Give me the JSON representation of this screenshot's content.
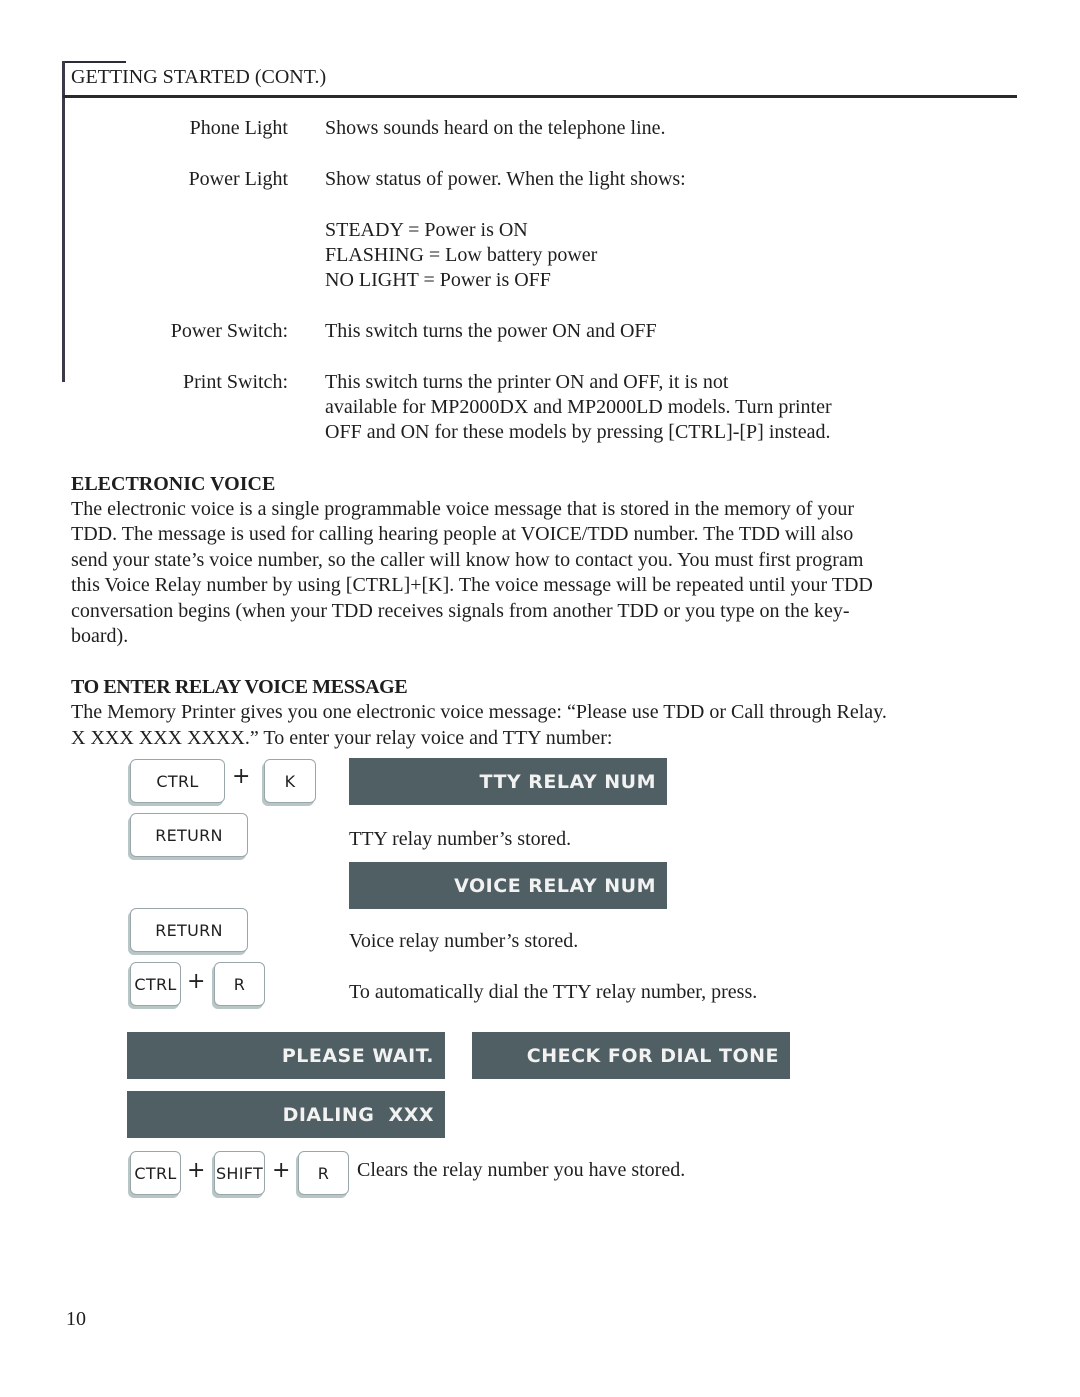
{
  "header": {
    "title": "GETTING STARTED (CONT.)"
  },
  "definitions": [
    {
      "term": "Phone Light",
      "desc": [
        "Shows sounds heard on the telephone line."
      ]
    },
    {
      "term": "Power Light",
      "desc": [
        "Show status of power. When the light shows:"
      ]
    },
    {
      "term": "",
      "desc": [
        "STEADY = Power is ON",
        "FLASHING = Low battery power",
        "NO  LIGHT = Power is OFF"
      ]
    },
    {
      "term": "Power Switch:",
      "desc": [
        "This switch turns the power ON and OFF"
      ]
    },
    {
      "term": "Print Switch:",
      "desc": [
        "This switch turns the printer ON and OFF, it is not",
        "available for MP2000DX and MP2000LD models. Turn printer",
        "OFF and ON for these models by pressing [CTRL]-[P] instead."
      ]
    }
  ],
  "electronic_voice": {
    "heading": "ELECTRONIC VOICE",
    "lines": [
      "The electronic voice is a single programmable voice message that is stored in the memory of your",
      "TDD. The message is used for calling hearing people at VOICE/TDD number. The TDD will also",
      "send your state’s voice number, so the caller will know how to contact you. You must first program",
      "this Voice Relay number by using [CTRL]+[K]. The voice message will be repeated until your TDD",
      "conversation begins (when your TDD receives signals from another TDD or you type on the key-",
      "board)."
    ]
  },
  "relay_section": {
    "heading": "TO ENTER RELAY VOICE MESSAGE",
    "lines": [
      "The Memory Printer gives you one electronic voice message: “Please use TDD or Call through Relay.",
      "X XXX XXX XXXX.” To enter your relay voice and TTY number:"
    ]
  },
  "steps": {
    "step1": {
      "keys": [
        "CTRL",
        "K"
      ],
      "plus": "+",
      "display": "TTY RELAY NUM"
    },
    "step2": {
      "keys": [
        "RETURN"
      ],
      "note": "TTY relay number’s stored.",
      "display": "VOICE RELAY NUM"
    },
    "step3": {
      "keys": [
        "RETURN"
      ],
      "note": "Voice relay number’s stored."
    },
    "step4": {
      "keys": [
        "CTRL",
        "R"
      ],
      "plus": "+",
      "note": "To automatically dial the TTY relay number, press."
    },
    "displays": [
      "PLEASE WAIT.",
      "CHECK FOR DIAL TONE",
      "DIALING  XXX"
    ],
    "step5": {
      "keys": [
        "CTRL",
        "SHIFT",
        "R"
      ],
      "plus": "+",
      "note": "Clears the relay number you have stored."
    }
  },
  "page_number": "10",
  "colors": {
    "lcd_background": "#4f5f63",
    "lcd_text": "#f2f2f2",
    "key_border": "#9aa7aa",
    "key_shadow": "#b8c6c6"
  }
}
